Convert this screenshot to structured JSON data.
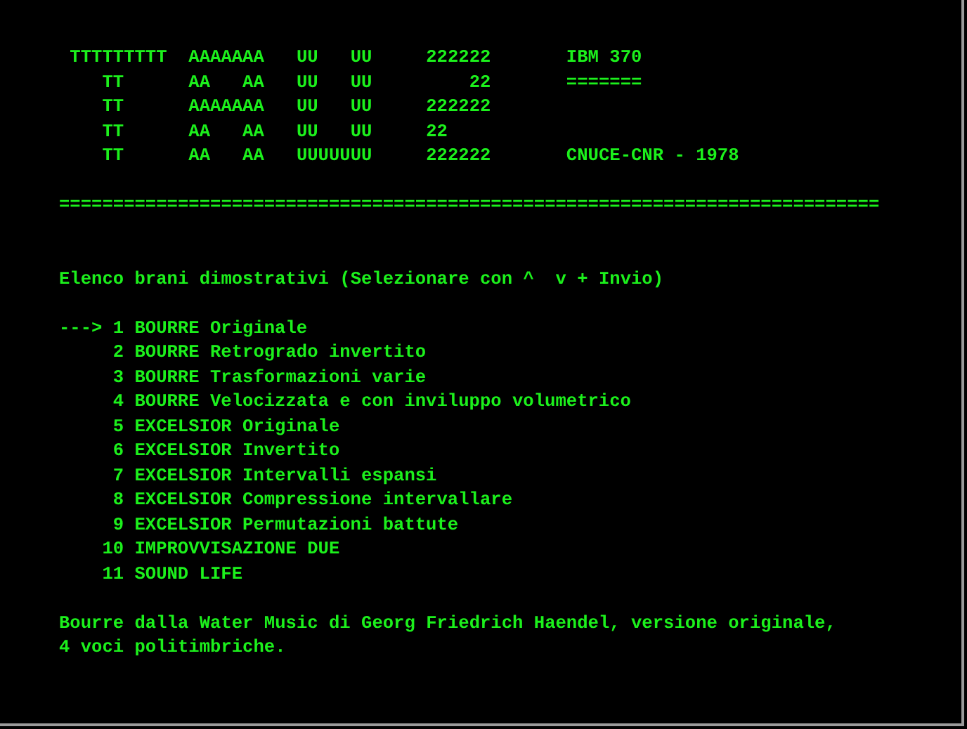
{
  "banner": [
    {
      "letters": " TTTTTTTTT  AAAAAAA   UU   UU     222222",
      "note": "IBM 370"
    },
    {
      "letters": "    TT      AA   AA   UU   UU         22",
      "note": "======="
    },
    {
      "letters": "    TT      AAAAAAA   UU   UU     222222"
    },
    {
      "letters": "    TT      AA   AA   UU   UU     22"
    },
    {
      "letters": "    TT      AA   AA   UUUUUUU     222222",
      "note": "CNUCE-CNR - 1978"
    }
  ],
  "separator": "============================================================================",
  "menu": {
    "heading": "Elenco brani dimostrativi (Selezionare con ^  v + Invio)",
    "cursor": "--->",
    "items": [
      {
        "number": "1",
        "title": "BOURRE Originale",
        "selected": true
      },
      {
        "number": "2",
        "title": "BOURRE Retrogrado invertito",
        "selected": false
      },
      {
        "number": "3",
        "title": "BOURRE Trasformazioni varie",
        "selected": false
      },
      {
        "number": "4",
        "title": "BOURRE Velocizzata e con inviluppo volumetrico",
        "selected": false
      },
      {
        "number": "5",
        "title": "EXCELSIOR Originale",
        "selected": false
      },
      {
        "number": "6",
        "title": "EXCELSIOR Invertito",
        "selected": false
      },
      {
        "number": "7",
        "title": "EXCELSIOR Intervalli espansi",
        "selected": false
      },
      {
        "number": "8",
        "title": "EXCELSIOR Compressione intervallare",
        "selected": false
      },
      {
        "number": "9",
        "title": "EXCELSIOR Permutazioni battute",
        "selected": false
      },
      {
        "number": "10",
        "title": "IMPROVVISAZIONE DUE",
        "selected": false
      },
      {
        "number": "11",
        "title": "SOUND LIFE",
        "selected": false
      }
    ]
  },
  "description": [
    "Bourre dalla Water Music di Georg Friedrich Haendel, versione originale,",
    "4 voci politimbriche."
  ]
}
